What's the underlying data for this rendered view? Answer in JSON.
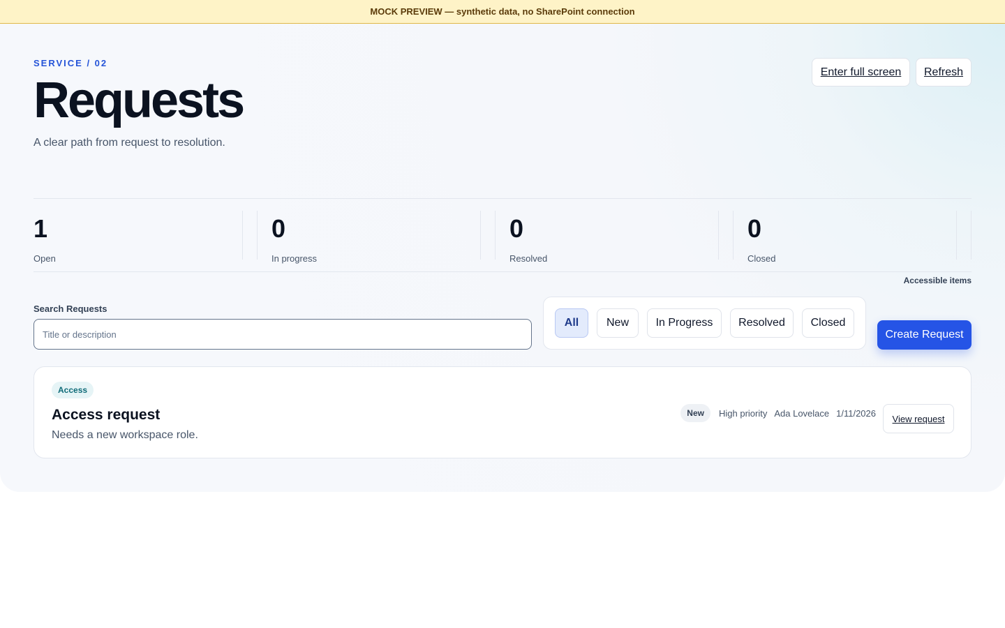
{
  "banner": {
    "text": "MOCK PREVIEW — synthetic data, no SharePoint connection"
  },
  "header": {
    "eyebrow": "SERVICE / 02",
    "title": "Requests",
    "subtitle": "A clear path from request to resolution.",
    "fullscreen_label": "Enter full screen",
    "refresh_label": "Refresh"
  },
  "stats": [
    {
      "value": "1",
      "label": "Open"
    },
    {
      "value": "0",
      "label": "In progress"
    },
    {
      "value": "0",
      "label": "Resolved"
    },
    {
      "value": "0",
      "label": "Closed"
    }
  ],
  "accessible_label": "Accessible items",
  "search": {
    "label": "Search Requests",
    "placeholder": "Title or description",
    "value": ""
  },
  "filters": [
    {
      "label": "All",
      "active": true
    },
    {
      "label": "New",
      "active": false
    },
    {
      "label": "In Progress",
      "active": false
    },
    {
      "label": "Resolved",
      "active": false
    },
    {
      "label": "Closed",
      "active": false
    }
  ],
  "create_label": "Create Request",
  "requests": [
    {
      "category": "Access",
      "title": "Access request",
      "description": "Needs a new workspace role.",
      "status": "New",
      "priority": "High priority",
      "assignee": "Ada Lovelace",
      "date": "1/11/2026",
      "view_label": "View request"
    }
  ],
  "colors": {
    "accent": "#2554e6",
    "eyebrow": "#2554d8",
    "banner_bg": "#fef3c7",
    "category_bg": "#e6f4f6",
    "category_fg": "#0f6b78"
  }
}
